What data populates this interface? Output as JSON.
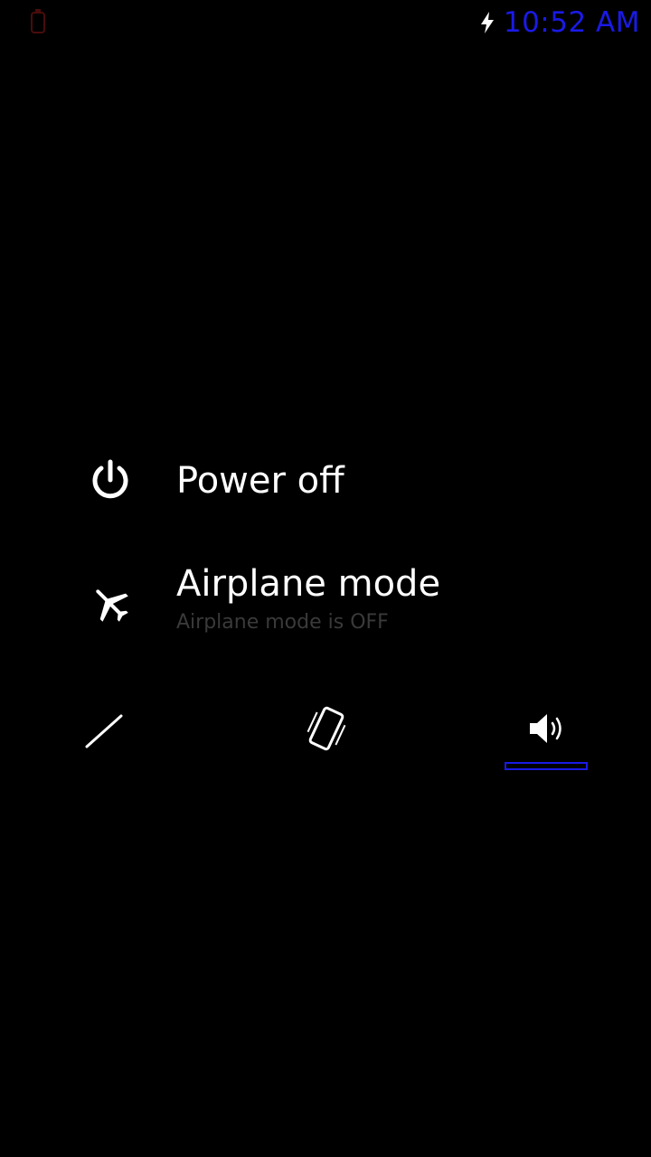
{
  "status_bar": {
    "time": "10:52 AM",
    "notification_icon": "notification-icon",
    "charging_icon": "charging-bolt-icon",
    "accent_color": "#1a1ae6"
  },
  "power_menu": {
    "items": [
      {
        "title": "Power off",
        "icon": "power-icon"
      },
      {
        "title": "Airplane mode",
        "subtitle": "Airplane mode is OFF",
        "icon": "airplane-icon"
      }
    ],
    "sound_modes": [
      {
        "mode": "silent",
        "icon": "silent-icon",
        "selected": false
      },
      {
        "mode": "vibrate",
        "icon": "vibrate-icon",
        "selected": false
      },
      {
        "mode": "ring",
        "icon": "volume-icon",
        "selected": true
      }
    ]
  }
}
